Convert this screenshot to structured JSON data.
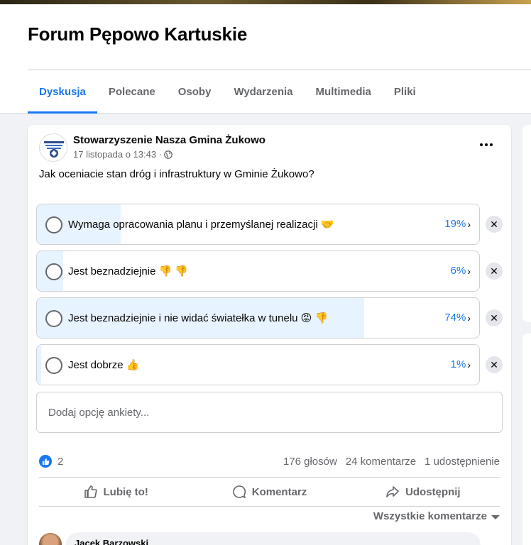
{
  "group": {
    "title": "Forum Pępowo Kartuskie",
    "tabs": [
      {
        "label": "Dyskusja",
        "active": true
      },
      {
        "label": "Polecane",
        "active": false
      },
      {
        "label": "Osoby",
        "active": false
      },
      {
        "label": "Wydarzenia",
        "active": false
      },
      {
        "label": "Multimedia",
        "active": false
      },
      {
        "label": "Pliki",
        "active": false
      }
    ]
  },
  "post": {
    "author": "Stowarzyszenie Nasza Gmina Żukowo",
    "timestamp": "17 listopada o 13:43 ·",
    "question": "Jak oceniacie stan dróg i infrastruktury w Gminie Żukowo?",
    "options": [
      {
        "label": "Wymaga opracowania planu i przemyślanej realizacji 🤝",
        "percent": "19%",
        "value": 19
      },
      {
        "label": "Jest beznadziejnie 👎 👎",
        "percent": "6%",
        "value": 6
      },
      {
        "label": "Jest beznadziejnie i nie widać światełka w tunelu 😡 👎",
        "percent": "74%",
        "value": 74
      },
      {
        "label": "Jest dobrze 👍",
        "percent": "1%",
        "value": 1
      }
    ],
    "add_option_placeholder": "Dodaj opcję ankiety...",
    "likes": "2",
    "votes": "176 głosów",
    "comments_count": "24 komentarze",
    "shares": "1 udostępnienie",
    "actions": {
      "like": "Lubię to!",
      "comment": "Komentarz",
      "share": "Udostępnij"
    },
    "all_comments": "Wszystkie komentarze",
    "first_comment_author": "Jacek Barzowski"
  },
  "colors": {
    "accent": "#1877f2",
    "fill": "#e7f3ff",
    "muted": "#65676b"
  }
}
